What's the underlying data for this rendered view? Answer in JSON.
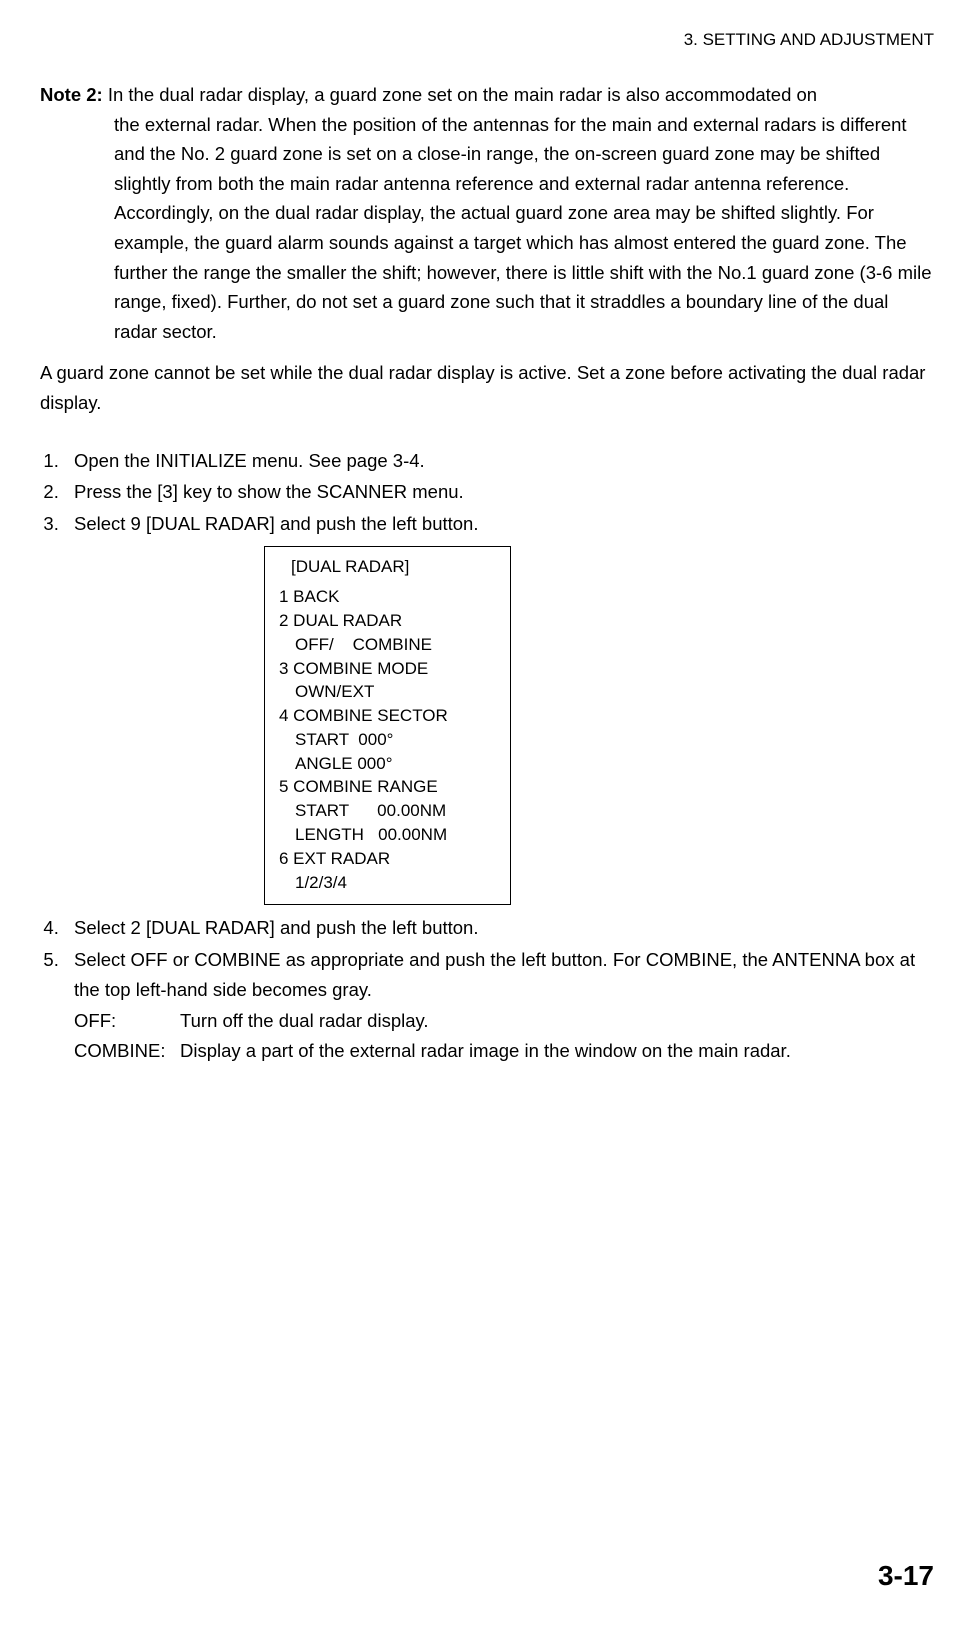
{
  "header": "3. SETTING AND ADJUSTMENT",
  "note": {
    "label": "Note 2:",
    "first_line": " In the dual radar display, a guard zone set on the main radar is also accommodated on",
    "body": "the external radar. When the position of the antennas for the main and external radars is different and the No. 2 guard zone is set on a close-in range, the on-screen guard zone may be shifted slightly from both the main radar antenna reference and external radar antenna reference. Accordingly, on the dual radar display, the actual guard zone area may be shifted slightly. For example, the guard alarm sounds against a target which has almost entered the guard zone. The further the range the smaller the shift; however, there is little shift with the No.1 guard zone (3-6 mile range, fixed). Further, do not set a guard zone such that it straddles a boundary line of the dual radar sector."
  },
  "guard_zone_text": "A guard zone cannot be set while the dual radar display is active. Set a zone before activating the dual radar display.",
  "steps": {
    "s1": "Open the INITIALIZE menu. See page 3-4.",
    "s2": "Press the [3] key to show the SCANNER menu.",
    "s3": "Select 9 [DUAL RADAR] and push the left button.",
    "s4": "Select 2 [DUAL RADAR] and push the left button.",
    "s5": "Select OFF or COMBINE as appropriate and push the left button. For COMBINE, the ANTENNA box at the top left-hand side becomes gray.",
    "s5_off_label": "OFF:",
    "s5_off_text": "Turn off the dual radar display.",
    "s5_combine_label": "COMBINE:",
    "s5_combine_text": "Display a part of the external radar image in the window on the main radar."
  },
  "menu": {
    "title": "[DUAL  RADAR]",
    "m1": "1 BACK",
    "m2": "2 DUAL RADAR",
    "m2_sub": "OFF/    COMBINE",
    "m3": "3 COMBINE MODE",
    "m3_sub": "OWN/EXT",
    "m4": "4 COMBINE SECTOR",
    "m4_sub1": "START  000°",
    "m4_sub2": "ANGLE 000°",
    "m5": "5 COMBINE RANGE",
    "m5_sub1": "START      00.00NM",
    "m5_sub2": "LENGTH   00.00NM",
    "m6": "6 EXT RADAR",
    "m6_sub": "1/2/3/4"
  },
  "page_number": "3-17"
}
